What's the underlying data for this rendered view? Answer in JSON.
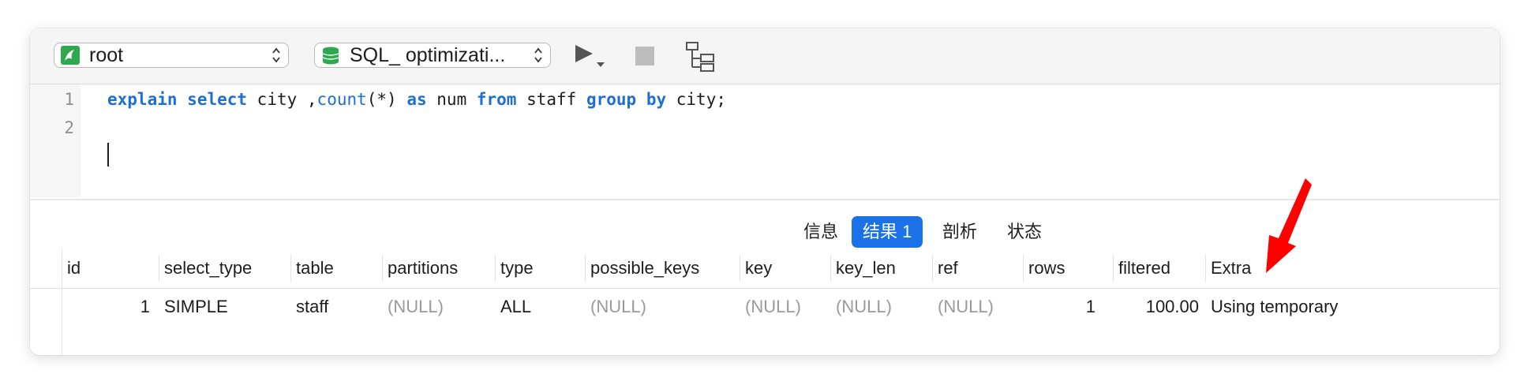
{
  "toolbar": {
    "connection": "root",
    "database": "SQL_ optimizati...",
    "connection_icon": "mysql-dolphin-icon",
    "database_icon": "database-cylinder-icon",
    "run_icon": "play-icon",
    "stop_icon": "stop-icon",
    "plan_icon": "explain-plan-icon"
  },
  "editor": {
    "line_numbers": [
      "1",
      "2"
    ],
    "line1": {
      "t1": "explain",
      "t2": " ",
      "t3": "select",
      "t4": " city ,",
      "t5": "count",
      "t6": "(*) ",
      "t7": "as",
      "t8": " num ",
      "t9": "from",
      "t10": " staff ",
      "t11": "group",
      "t12": " ",
      "t13": "by",
      "t14": " city;"
    }
  },
  "tabs": [
    "信息",
    "结果 1",
    "剖析",
    "状态"
  ],
  "active_tab": "结果 1",
  "results": {
    "columns": [
      "id",
      "select_type",
      "table",
      "partitions",
      "type",
      "possible_keys",
      "key",
      "key_len",
      "ref",
      "rows",
      "filtered",
      "Extra"
    ],
    "rows": [
      [
        "1",
        "SIMPLE",
        "staff",
        "(NULL)",
        "ALL",
        "(NULL)",
        "(NULL)",
        "(NULL)",
        "(NULL)",
        "1",
        "100.00",
        "Using temporary"
      ]
    ]
  },
  "colors": {
    "keyword": "#1f6fd1",
    "active_tab": "#1b72e8",
    "null_text": "#9a9a9a",
    "annotation_arrow": "#ff0000"
  }
}
